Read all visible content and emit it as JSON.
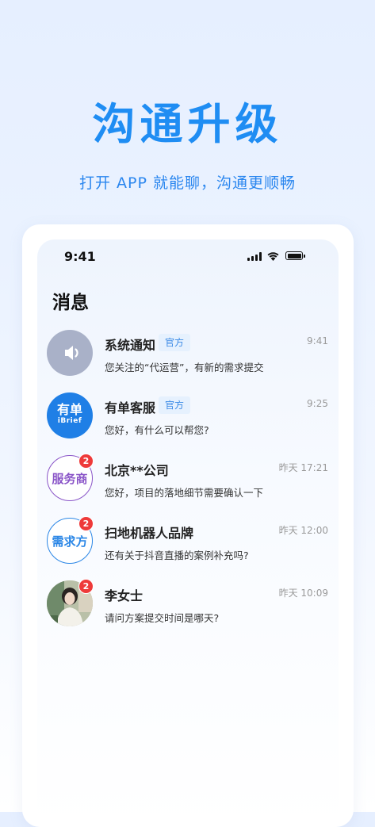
{
  "hero": {
    "title": "沟通升级",
    "subtitle": "打开 APP 就能聊，沟通更顺畅"
  },
  "status_bar": {
    "time": "9:41",
    "icons": [
      "signal-icon",
      "wifi-icon",
      "battery-icon"
    ]
  },
  "page": {
    "title": "消息"
  },
  "messages": [
    {
      "name": "系统通知",
      "tag": "官方",
      "time": "9:41",
      "preview": "您关注的“代运营”，有新的需求提交",
      "avatar_icon": "speaker-icon",
      "avatar_color": "#a9b1c8"
    },
    {
      "name": "有单客服",
      "tag": "官方",
      "time": "9:25",
      "preview": "您好，有什么可以帮您?",
      "avatar_logo_main": "有单",
      "avatar_logo_sub": "iBrief",
      "avatar_color": "#1f7fe6"
    },
    {
      "name": "北京**公司",
      "time": "昨天 17:21",
      "preview": "您好，项目的落地细节需要确认一下",
      "avatar_text": "服务商",
      "avatar_color": "#8a55c8",
      "badge": "2"
    },
    {
      "name": "扫地机器人品牌",
      "time": "昨天 12:00",
      "preview": "还有关于抖音直播的案例补充吗?",
      "avatar_text": "需求方",
      "avatar_color": "#2a86e6",
      "badge": "2"
    },
    {
      "name": "李女士",
      "time": "昨天 10:09",
      "preview": "请问方案提交时间是哪天?",
      "avatar_icon": "user-photo-icon",
      "badge": "2"
    }
  ]
}
